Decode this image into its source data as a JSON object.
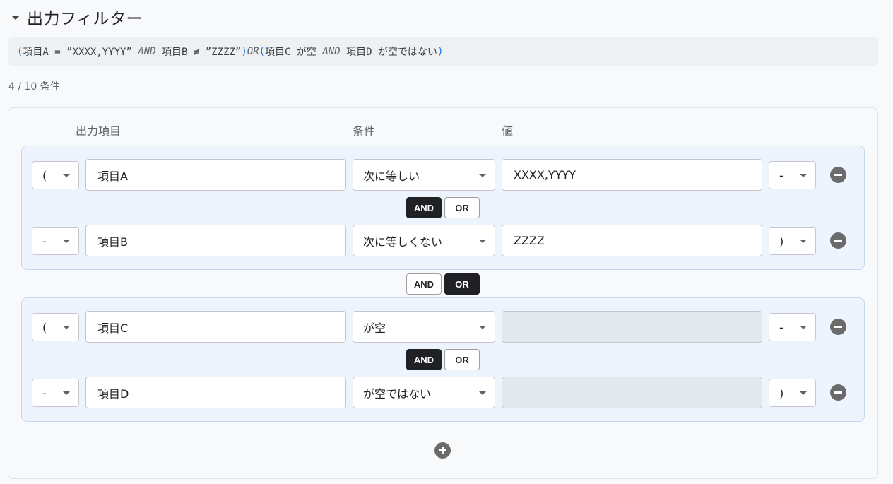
{
  "section": {
    "title": "出力フィルター",
    "expanded": true
  },
  "expression": {
    "p1": "(",
    "a": "項目A = ”XXXX,YYYY” ",
    "op1": "AND",
    "b": " 項目B ≠ ”ZZZZ”",
    "p2": ")",
    "op2": "OR",
    "p3": "(",
    "c": "項目C が空 ",
    "op3": "AND",
    "d": " 項目D が空ではない",
    "p4": ")"
  },
  "count": "4 / 10 条件",
  "columns": {
    "item": "出力項目",
    "condition": "条件",
    "value": "値"
  },
  "rows": [
    {
      "open": "(",
      "item": "項目A",
      "condition": "次に等しい",
      "value": "XXXX,YYYY",
      "close": "-",
      "value_disabled": false
    },
    {
      "open": "-",
      "item": "項目B",
      "condition": "次に等しくない",
      "value": "ZZZZ",
      "close": ")",
      "value_disabled": false
    },
    {
      "open": "(",
      "item": "項目C",
      "condition": "が空",
      "value": "",
      "close": "-",
      "value_disabled": true
    },
    {
      "open": "-",
      "item": "項目D",
      "condition": "が空ではない",
      "value": "",
      "close": ")",
      "value_disabled": true
    }
  ],
  "connectors": {
    "row1_row2": {
      "and": "AND",
      "or": "OR",
      "selected": "AND"
    },
    "group1_group2": {
      "and": "AND",
      "or": "OR",
      "selected": "OR"
    },
    "row3_row4": {
      "and": "AND",
      "or": "OR",
      "selected": "AND"
    }
  },
  "icons": {
    "collapse": "caret-down-icon",
    "remove": "remove-circle-icon",
    "add": "add-circle-icon",
    "dropdown": "chevron-down-icon"
  },
  "colors": {
    "group_bg": "#eef4fe",
    "group_border": "#c8d8f2",
    "active_toggle": "#202124",
    "paren": "#1a73e8"
  }
}
